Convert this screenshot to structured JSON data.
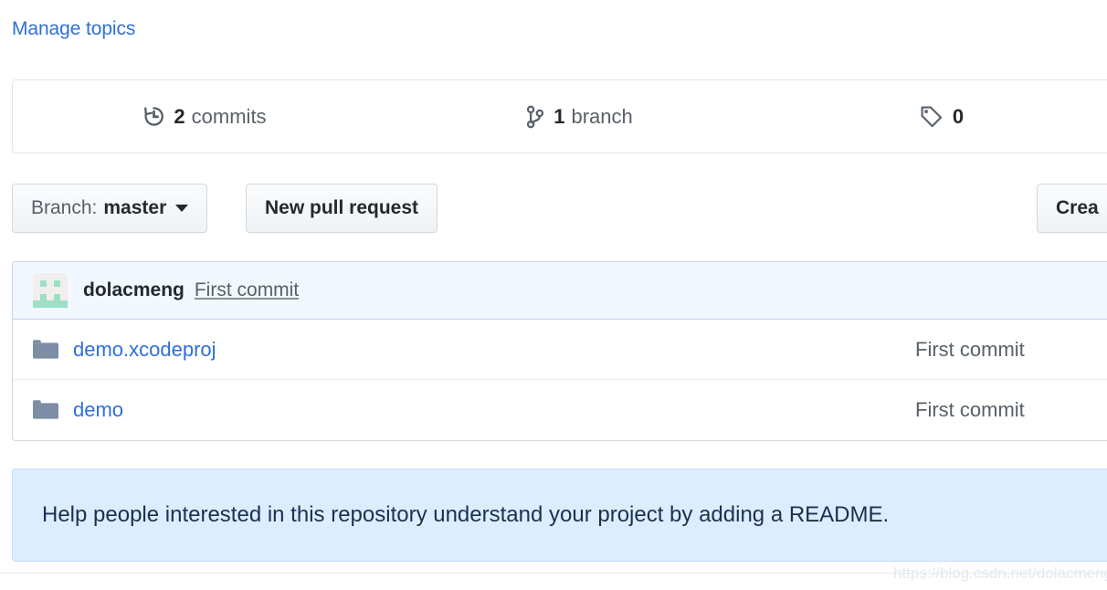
{
  "topics": {
    "manage_link": "Manage topics"
  },
  "stats": [
    {
      "icon": "history-icon",
      "count": "2",
      "label": "commits"
    },
    {
      "icon": "git-branch-icon",
      "count": "1",
      "label": "branch"
    },
    {
      "icon": "tag-icon",
      "count": "0",
      "label": ""
    }
  ],
  "buttons": {
    "branch_prefix": "Branch:",
    "branch_name": "master",
    "new_pull_request": "New pull request",
    "create_new_file": "Crea"
  },
  "latest_commit": {
    "author": "dolacmeng",
    "message": "First commit"
  },
  "files": [
    {
      "icon": "folder-icon",
      "name": "demo.xcodeproj",
      "commit_message": "First commit"
    },
    {
      "icon": "folder-icon",
      "name": "demo",
      "commit_message": "First commit"
    }
  ],
  "readme_banner": {
    "text": "Help people interested in this repository understand your project by adding a README."
  },
  "watermark": {
    "text": "https://blog.csdn.net/dolacmeng"
  },
  "colors": {
    "link_blue": "#2f6fdb",
    "text_dark": "#24292e",
    "text_muted": "#586069",
    "banner_bg": "#dbedff",
    "banner_text": "#1c3050",
    "commit_row_bg": "#f1f8ff",
    "folder_icon": "#7d8da3",
    "identicon_green": "#9ce0c6",
    "identicon_bg": "#f0efee"
  }
}
